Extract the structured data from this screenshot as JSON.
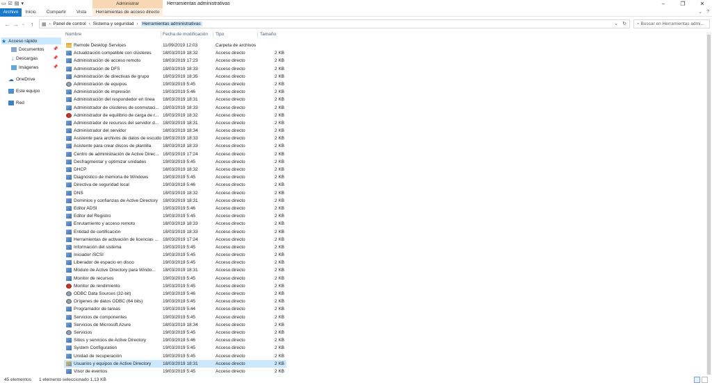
{
  "window": {
    "title": "Herramientas administrativas",
    "context_tab_group": "Administrar"
  },
  "ribbon": {
    "tabs": [
      "Archivo",
      "Inicio",
      "Compartir",
      "Vista",
      "Herramientas de acceso directo"
    ]
  },
  "address": {
    "crumbs": [
      "Panel de control",
      "Sistema y seguridad",
      "Herramientas administrativas"
    ],
    "search_placeholder": "Buscar en Herramientas admi..."
  },
  "nav": {
    "quick_access": "Acceso rápido",
    "pinned": [
      "Documentos",
      "Descargas",
      "Imágenes"
    ],
    "onedrive": "OneDrive",
    "this_pc": "Este equipo",
    "network": "Red"
  },
  "columns": {
    "name": "Nombre",
    "date": "Fecha de modificación",
    "type": "Tipo",
    "size": "Tamaño"
  },
  "files": [
    {
      "name": "Remote Desktop Services",
      "date": "11/09/2019 12:03",
      "type": "Carpeta de archivos",
      "size": "",
      "icon": "folder"
    },
    {
      "name": "Actualización compatible con clústeres",
      "date": "18/03/2019 18:32",
      "type": "Acceso directo",
      "size": "2 KB",
      "icon": "shortcut"
    },
    {
      "name": "Administración de acceso remoto",
      "date": "18/03/2019 17:23",
      "type": "Acceso directo",
      "size": "2 KB",
      "icon": "shortcut"
    },
    {
      "name": "Administración de DFS",
      "date": "18/03/2019 18:33",
      "type": "Acceso directo",
      "size": "2 KB",
      "icon": "shortcut"
    },
    {
      "name": "Administración de directivas de grupo",
      "date": "18/03/2019 18:35",
      "type": "Acceso directo",
      "size": "2 KB",
      "icon": "shortcut"
    },
    {
      "name": "Administración de equipos",
      "date": "19/03/2019 5:45",
      "type": "Acceso directo",
      "size": "2 KB",
      "icon": "gear"
    },
    {
      "name": "Administración de impresión",
      "date": "19/03/2019 5:46",
      "type": "Acceso directo",
      "size": "2 KB",
      "icon": "shortcut"
    },
    {
      "name": "Administración del respondedor en línea",
      "date": "18/03/2019 18:31",
      "type": "Acceso directo",
      "size": "2 KB",
      "icon": "shortcut"
    },
    {
      "name": "Administrador de clústeres de conmutaci...",
      "date": "18/03/2019 18:33",
      "type": "Acceso directo",
      "size": "2 KB",
      "icon": "shortcut"
    },
    {
      "name": "Administrador de equilibrio de carga de r...",
      "date": "18/03/2019 18:32",
      "type": "Acceso directo",
      "size": "2 KB",
      "icon": "red"
    },
    {
      "name": "Administrador de recursos del servidor d...",
      "date": "18/03/2019 18:31",
      "type": "Acceso directo",
      "size": "2 KB",
      "icon": "shortcut"
    },
    {
      "name": "Administrador del servidor",
      "date": "18/03/2019 18:34",
      "type": "Acceso directo",
      "size": "2 KB",
      "icon": "shortcut"
    },
    {
      "name": "Asistente para archivos de datos de escudo",
      "date": "18/03/2019 18:33",
      "type": "Acceso directo",
      "size": "2 KB",
      "icon": "shortcut"
    },
    {
      "name": "Asistente para crear discos de plantilla",
      "date": "18/03/2019 18:33",
      "type": "Acceso directo",
      "size": "2 KB",
      "icon": "shortcut"
    },
    {
      "name": "Centro de administración de Active Direc...",
      "date": "18/03/2019 17:24",
      "type": "Acceso directo",
      "size": "2 KB",
      "icon": "shortcut"
    },
    {
      "name": "Desfragmentar y optimizar unidades",
      "date": "19/03/2019 5:45",
      "type": "Acceso directo",
      "size": "2 KB",
      "icon": "shortcut"
    },
    {
      "name": "DHCP",
      "date": "18/03/2019 18:32",
      "type": "Acceso directo",
      "size": "2 KB",
      "icon": "shortcut"
    },
    {
      "name": "Diagnóstico de memoria de Windows",
      "date": "19/03/2019 5:45",
      "type": "Acceso directo",
      "size": "2 KB",
      "icon": "shortcut"
    },
    {
      "name": "Directiva de seguridad local",
      "date": "19/03/2019 5:46",
      "type": "Acceso directo",
      "size": "2 KB",
      "icon": "shortcut"
    },
    {
      "name": "DNS",
      "date": "18/03/2019 18:32",
      "type": "Acceso directo",
      "size": "2 KB",
      "icon": "shortcut"
    },
    {
      "name": "Dominios y confianzas de Active Directory",
      "date": "18/03/2019 18:31",
      "type": "Acceso directo",
      "size": "2 KB",
      "icon": "shortcut"
    },
    {
      "name": "Editor ADSI",
      "date": "19/03/2019 5:46",
      "type": "Acceso directo",
      "size": "2 KB",
      "icon": "shortcut"
    },
    {
      "name": "Editor del Registro",
      "date": "19/03/2019 5:45",
      "type": "Acceso directo",
      "size": "2 KB",
      "icon": "shortcut"
    },
    {
      "name": "Enrutamiento y acceso remoto",
      "date": "18/03/2019 18:33",
      "type": "Acceso directo",
      "size": "2 KB",
      "icon": "shortcut"
    },
    {
      "name": "Entidad de certificación",
      "date": "18/03/2019 18:33",
      "type": "Acceso directo",
      "size": "2 KB",
      "icon": "shortcut"
    },
    {
      "name": "Herramientas de activación de licencias ...",
      "date": "18/03/2019 17:24",
      "type": "Acceso directo",
      "size": "2 KB",
      "icon": "shortcut"
    },
    {
      "name": "Información del sistema",
      "date": "19/03/2019 5:45",
      "type": "Acceso directo",
      "size": "2 KB",
      "icon": "shortcut"
    },
    {
      "name": "Iniciador iSCSI",
      "date": "19/03/2019 5:45",
      "type": "Acceso directo",
      "size": "2 KB",
      "icon": "shortcut"
    },
    {
      "name": "Liberador de espacio en disco",
      "date": "19/03/2019 5:45",
      "type": "Acceso directo",
      "size": "2 KB",
      "icon": "shortcut"
    },
    {
      "name": "Módulo de Active Directory para Windo...",
      "date": "18/03/2019 18:31",
      "type": "Acceso directo",
      "size": "2 KB",
      "icon": "shortcut"
    },
    {
      "name": "Monitor de recursos",
      "date": "19/03/2019 5:45",
      "type": "Acceso directo",
      "size": "2 KB",
      "icon": "shortcut"
    },
    {
      "name": "Monitor de rendimiento",
      "date": "19/03/2019 5:45",
      "type": "Acceso directo",
      "size": "2 KB",
      "icon": "red"
    },
    {
      "name": "ODBC Data Sources (32-bit)",
      "date": "19/03/2019 5:46",
      "type": "Acceso directo",
      "size": "2 KB",
      "icon": "gear"
    },
    {
      "name": "Orígenes de datos ODBC (64 bits)",
      "date": "19/03/2019 5:45",
      "type": "Acceso directo",
      "size": "2 KB",
      "icon": "gear"
    },
    {
      "name": "Programador de tareas",
      "date": "19/03/2019 5:44",
      "type": "Acceso directo",
      "size": "2 KB",
      "icon": "shortcut"
    },
    {
      "name": "Servicios de componentes",
      "date": "19/03/2019 5:45",
      "type": "Acceso directo",
      "size": "2 KB",
      "icon": "shortcut"
    },
    {
      "name": "Servicios de Microsoft Azure",
      "date": "18/03/2019 18:34",
      "type": "Acceso directo",
      "size": "2 KB",
      "icon": "shortcut"
    },
    {
      "name": "Servicios",
      "date": "19/03/2019 5:45",
      "type": "Acceso directo",
      "size": "2 KB",
      "icon": "gear"
    },
    {
      "name": "Sitios y servicios de Active Directory",
      "date": "19/03/2019 5:46",
      "type": "Acceso directo",
      "size": "2 KB",
      "icon": "shortcut"
    },
    {
      "name": "System Configuration",
      "date": "19/03/2019 5:45",
      "type": "Acceso directo",
      "size": "2 KB",
      "icon": "shortcut"
    },
    {
      "name": "Unidad de recuperación",
      "date": "19/03/2019 5:45",
      "type": "Acceso directo",
      "size": "2 KB",
      "icon": "shortcut"
    },
    {
      "name": "Usuarios y equipos de Active Directory",
      "date": "18/03/2019 18:31",
      "type": "Acceso directo",
      "size": "2 KB",
      "icon": "user",
      "selected": true
    },
    {
      "name": "Visor de eventos",
      "date": "19/03/2019 5:45",
      "type": "Acceso directo",
      "size": "2 KB",
      "icon": "shortcut"
    }
  ],
  "status": {
    "count": "45 elementos",
    "selection": "1 elemento seleccionado  1,13 KB"
  },
  "colors": {
    "file_tab": "#1979ca",
    "context_tab": "#f8d7b4",
    "selection": "#cce8ff"
  }
}
